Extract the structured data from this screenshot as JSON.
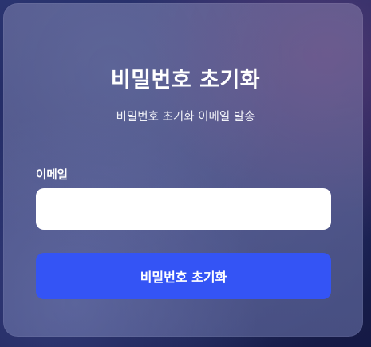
{
  "form": {
    "title": "비밀번호 초기화",
    "subtitle": "비밀번호 초기화 이메일 발송",
    "email_label": "이메일",
    "email_value": "",
    "email_placeholder": "",
    "submit_label": "비밀번호 초기화"
  },
  "colors": {
    "accent": "#3454f5",
    "input_background": "#ffffff",
    "text": "#ffffff"
  }
}
